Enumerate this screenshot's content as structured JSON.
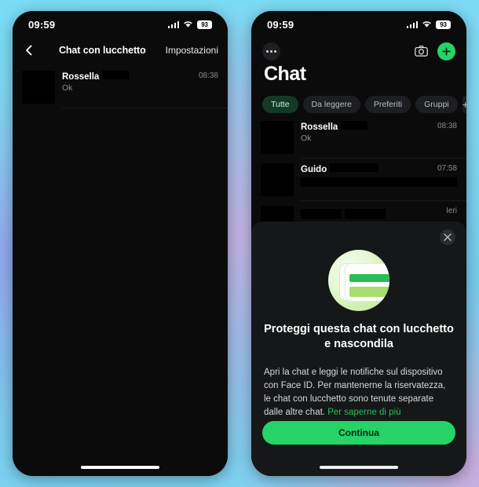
{
  "background": {
    "accent_cyan": "#79dbf5",
    "accent_lavender": "#c5b0e2"
  },
  "colors": {
    "whatsapp_green": "#25d366",
    "link_green": "#2bbd55",
    "chip_active_bg": "#133a26"
  },
  "left_phone": {
    "status_bar": {
      "time": "09:59",
      "battery": "93",
      "signal_icon": "cellular-bars-icon",
      "wifi_icon": "wifi-icon",
      "battery_icon": "battery-icon"
    },
    "nav": {
      "back_icon": "chevron-left-icon",
      "title": "Chat con lucchetto",
      "action": "Impostazioni"
    },
    "chats": [
      {
        "name": "Rossella",
        "preview": "Ok",
        "time": "08:38",
        "redacted_name_width": 34
      }
    ],
    "home_indicator": "home-indicator"
  },
  "right_phone": {
    "status_bar": {
      "time": "09:59",
      "battery": "93",
      "signal_icon": "cellular-bars-icon",
      "wifi_icon": "wifi-icon",
      "battery_icon": "battery-icon"
    },
    "top_actions": {
      "menu_icon": "more-options-icon",
      "camera_icon": "camera-icon",
      "new_chat_icon": "plus-icon"
    },
    "title": "Chat",
    "filters": [
      {
        "label": "Tutte",
        "active": true
      },
      {
        "label": "Da leggere",
        "active": false
      },
      {
        "label": "Preferiti",
        "active": false
      },
      {
        "label": "Gruppi",
        "active": false
      }
    ],
    "filter_add": "+",
    "chats": [
      {
        "name": "Rossella",
        "preview": "Ok",
        "time": "08:38",
        "redacted_name_width": 34
      },
      {
        "name": "Guido",
        "preview": "",
        "time": "07:58",
        "redacted_name_width": 62
      },
      {
        "name": "",
        "preview": "",
        "time": "Ieri",
        "redacted_name_width": 52
      }
    ],
    "sheet": {
      "close_icon": "close-icon",
      "illustration_icon": "locked-chat-illustration",
      "title": "Proteggi questa chat con lucchetto e nascondila",
      "body": "Apri la chat e leggi le notifiche sul dispositivo con Face ID. Per mantenerne la riservatezza, le chat con lucchetto sono tenute separate dalle altre chat. ",
      "link": "Per saperne di più",
      "cta": "Continua"
    },
    "home_indicator": "home-indicator"
  }
}
